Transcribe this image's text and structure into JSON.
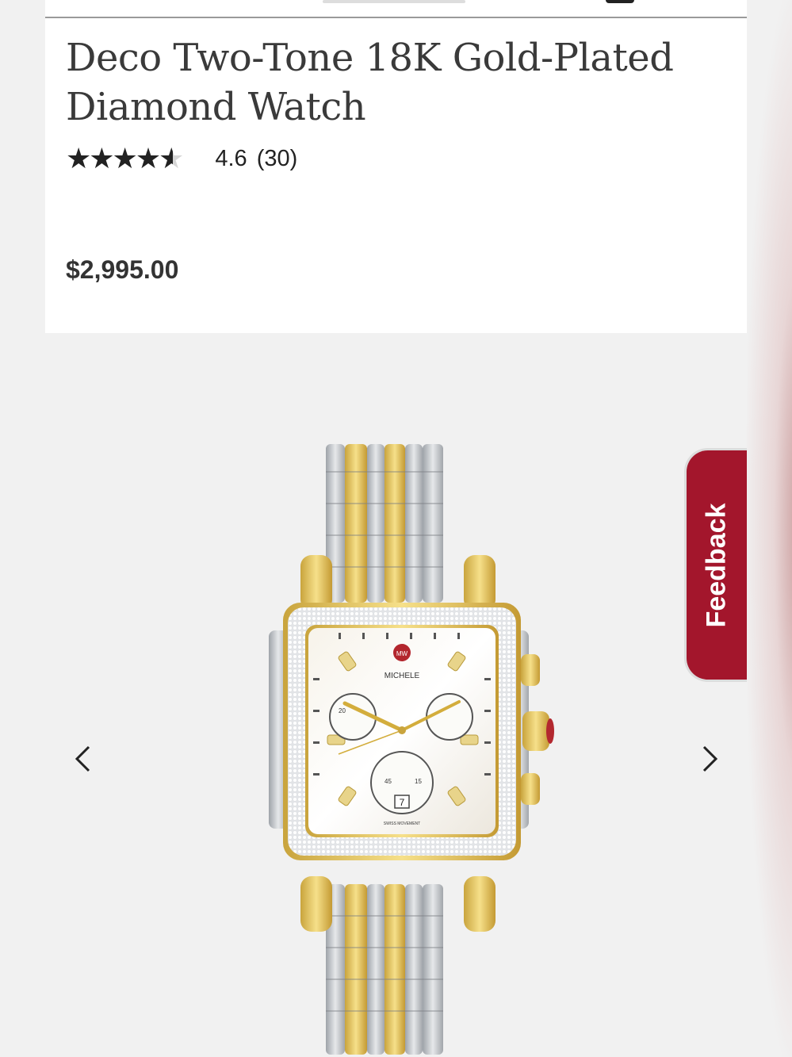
{
  "product": {
    "title": "Deco Two-Tone 18K Gold-Plated Diamond Watch",
    "rating": {
      "stars": "★★★★★",
      "value": 4.6,
      "max": 5,
      "value_text": "4.6",
      "count_text": "(30)"
    },
    "price": "$2,995.00"
  },
  "gallery": {
    "image_name": "deco-two-tone-watch-image",
    "watch_brand_text": "MICHELE",
    "logo_text": "MW",
    "dial_numbers": [
      "20",
      "45",
      "15",
      "7"
    ],
    "dial_caption": "SWISS MOVEMENT"
  },
  "feedback": {
    "label": "Feedback"
  },
  "colors": {
    "feedback_bg": "#a3162c",
    "price_text": "#333333",
    "title_text": "#3a3a3a",
    "gold": "#e0c15c",
    "silver": "#c4c7cb"
  },
  "icons": {
    "prev": "chevron-left-icon",
    "next": "chevron-right-icon"
  }
}
